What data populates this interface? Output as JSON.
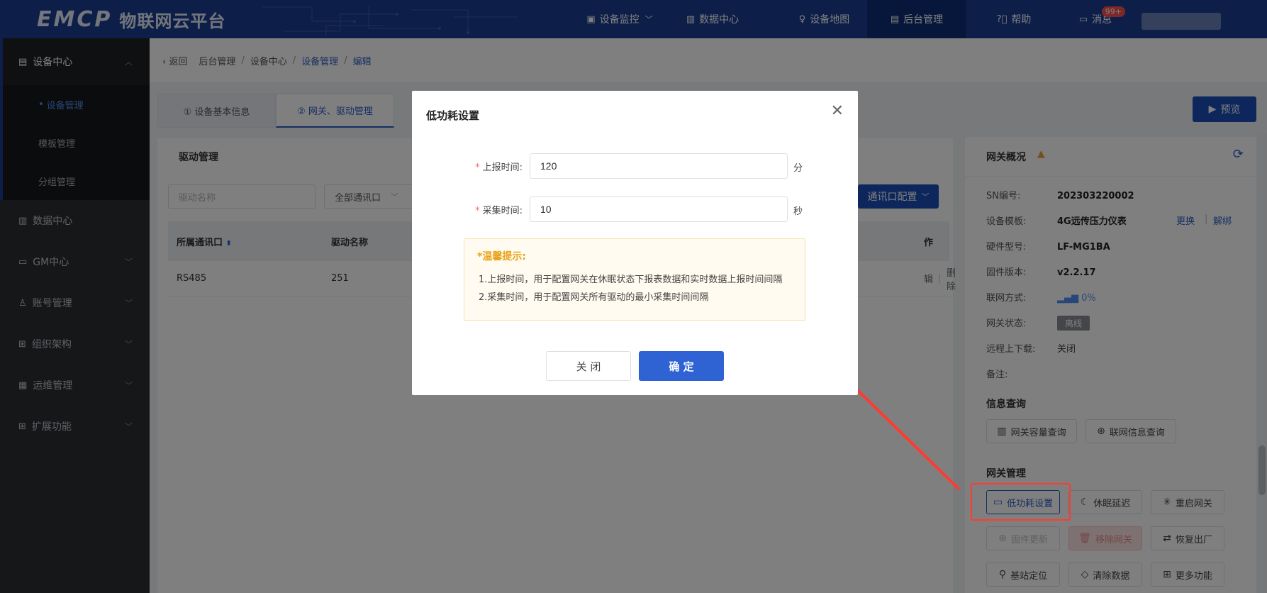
{
  "topbar": {
    "logo_mark": "EMCP",
    "logo_text": "物联网云平台",
    "nav": [
      {
        "label": "设备监控",
        "icon": "monitor-icon",
        "dropdown": true
      },
      {
        "label": "数据中心",
        "icon": "chart-icon"
      },
      {
        "label": "设备地图",
        "icon": "location-icon"
      },
      {
        "label": "后台管理",
        "icon": "admin-icon",
        "active": true
      },
      {
        "label": "帮助",
        "icon": "help-icon"
      },
      {
        "label": "消息",
        "icon": "message-icon",
        "badge": "99+"
      }
    ]
  },
  "sidebar": {
    "top_group": "设备中心",
    "sub_items": [
      "设备管理",
      "模板管理",
      "分组管理"
    ],
    "groups": [
      "数据中心",
      "GM中心",
      "账号管理",
      "组织架构",
      "运维管理",
      "扩展功能"
    ]
  },
  "breadcrumb": {
    "back": "返回",
    "items": [
      "后台管理",
      "设备中心",
      "设备管理",
      "编辑"
    ]
  },
  "tabs": [
    "① 设备基本信息",
    "② 网关、驱动管理"
  ],
  "preview_label": "预览",
  "driver_panel": {
    "title": "驱动管理",
    "name_placeholder": "驱动名称",
    "port_select": "全部通讯口",
    "port_config_btn": "通讯口配置",
    "columns": [
      "所属通讯口",
      "驱动名称",
      "作"
    ],
    "rows": [
      {
        "port": "RS485",
        "name": "251",
        "actions": [
          "辑",
          "删除"
        ]
      }
    ]
  },
  "gateway": {
    "title": "网关概况",
    "fields": [
      {
        "key": "SN编号:",
        "value": "202303220002"
      },
      {
        "key": "设备模板:",
        "value": "4G远传压力仪表"
      },
      {
        "key": "硬件型号:",
        "value": "LF-MG1BA"
      },
      {
        "key": "固件版本:",
        "value": "v2.2.17"
      },
      {
        "key": "联网方式:",
        "value": "0%"
      },
      {
        "key": "网关状态:",
        "value": "离线"
      },
      {
        "key": "远程上下载:",
        "value": "关闭"
      },
      {
        "key": "备注:",
        "value": ""
      }
    ],
    "links": [
      "更换",
      "解绑"
    ],
    "info_section": "信息查询",
    "info_buttons": [
      "网关容量查询",
      "联网信息查询"
    ],
    "manage_section": "网关管理",
    "manage_buttons": [
      "低功耗设置",
      "休眠延迟",
      "重启网关",
      "固件更新",
      "移除网关",
      "恢复出厂",
      "基站定位",
      "清除数据",
      "更多功能"
    ]
  },
  "modal": {
    "title": "低功耗设置",
    "report_label": "上报时间:",
    "report_value": "120",
    "report_unit": "分",
    "collect_label": "采集时间:",
    "collect_value": "10",
    "collect_unit": "秒",
    "tip_title": "*温馨提示:",
    "tip_lines": [
      "1.上报时间，用于配置网关在休眠状态下报表数据和实时数据上报时间间隔",
      "2.采集时间，用于配置网关所有驱动的最小采集时间间隔"
    ],
    "cancel_label": "关 闭",
    "ok_label": "确 定"
  },
  "colors": {
    "brand": "#1b3f92",
    "primary": "#2f63d3",
    "annotation": "#ff3b30"
  }
}
